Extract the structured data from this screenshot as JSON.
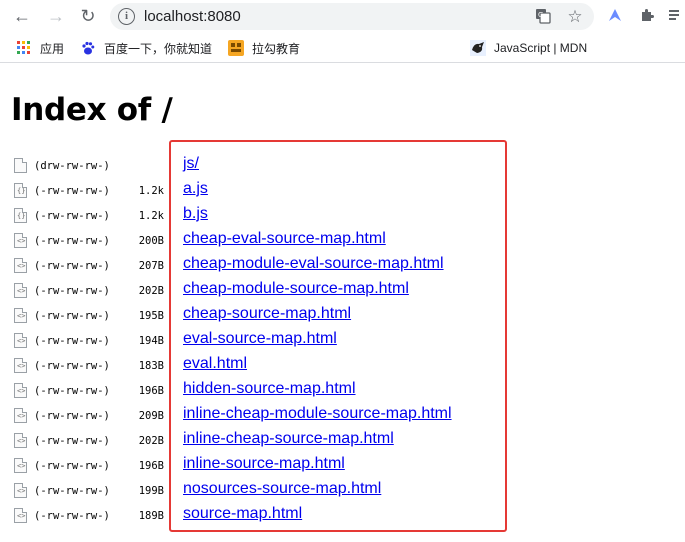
{
  "browser": {
    "url": "localhost:8080",
    "accent": "#1a73e8"
  },
  "bookmarks": [
    {
      "label": "应用",
      "icon": "apps-grid-icon"
    },
    {
      "label": "百度一下，你就知道",
      "icon": "baidu-paw-icon"
    },
    {
      "label": "拉勾教育",
      "icon": "lagou-icon"
    },
    {
      "label": "JavaScript | MDN",
      "icon": "mdn-icon"
    }
  ],
  "page": {
    "title": "Index of /",
    "entries": [
      {
        "perm": "(drw-rw-rw-)",
        "size": "",
        "name": "js/",
        "type": "folder"
      },
      {
        "perm": "(-rw-rw-rw-)",
        "size": "1.2k",
        "name": "a.js",
        "type": "js"
      },
      {
        "perm": "(-rw-rw-rw-)",
        "size": "1.2k",
        "name": "b.js",
        "type": "js"
      },
      {
        "perm": "(-rw-rw-rw-)",
        "size": "200B",
        "name": "cheap-eval-source-map.html",
        "type": "html"
      },
      {
        "perm": "(-rw-rw-rw-)",
        "size": "207B",
        "name": "cheap-module-eval-source-map.html",
        "type": "html"
      },
      {
        "perm": "(-rw-rw-rw-)",
        "size": "202B",
        "name": "cheap-module-source-map.html",
        "type": "html"
      },
      {
        "perm": "(-rw-rw-rw-)",
        "size": "195B",
        "name": "cheap-source-map.html",
        "type": "html"
      },
      {
        "perm": "(-rw-rw-rw-)",
        "size": "194B",
        "name": "eval-source-map.html",
        "type": "html"
      },
      {
        "perm": "(-rw-rw-rw-)",
        "size": "183B",
        "name": "eval.html",
        "type": "html"
      },
      {
        "perm": "(-rw-rw-rw-)",
        "size": "196B",
        "name": "hidden-source-map.html",
        "type": "html"
      },
      {
        "perm": "(-rw-rw-rw-)",
        "size": "209B",
        "name": "inline-cheap-module-source-map.html",
        "type": "html"
      },
      {
        "perm": "(-rw-rw-rw-)",
        "size": "202B",
        "name": "inline-cheap-source-map.html",
        "type": "html"
      },
      {
        "perm": "(-rw-rw-rw-)",
        "size": "196B",
        "name": "inline-source-map.html",
        "type": "html"
      },
      {
        "perm": "(-rw-rw-rw-)",
        "size": "199B",
        "name": "nosources-source-map.html",
        "type": "html"
      },
      {
        "perm": "(-rw-rw-rw-)",
        "size": "189B",
        "name": "source-map.html",
        "type": "html"
      }
    ]
  },
  "highlight_color": "#e53935"
}
